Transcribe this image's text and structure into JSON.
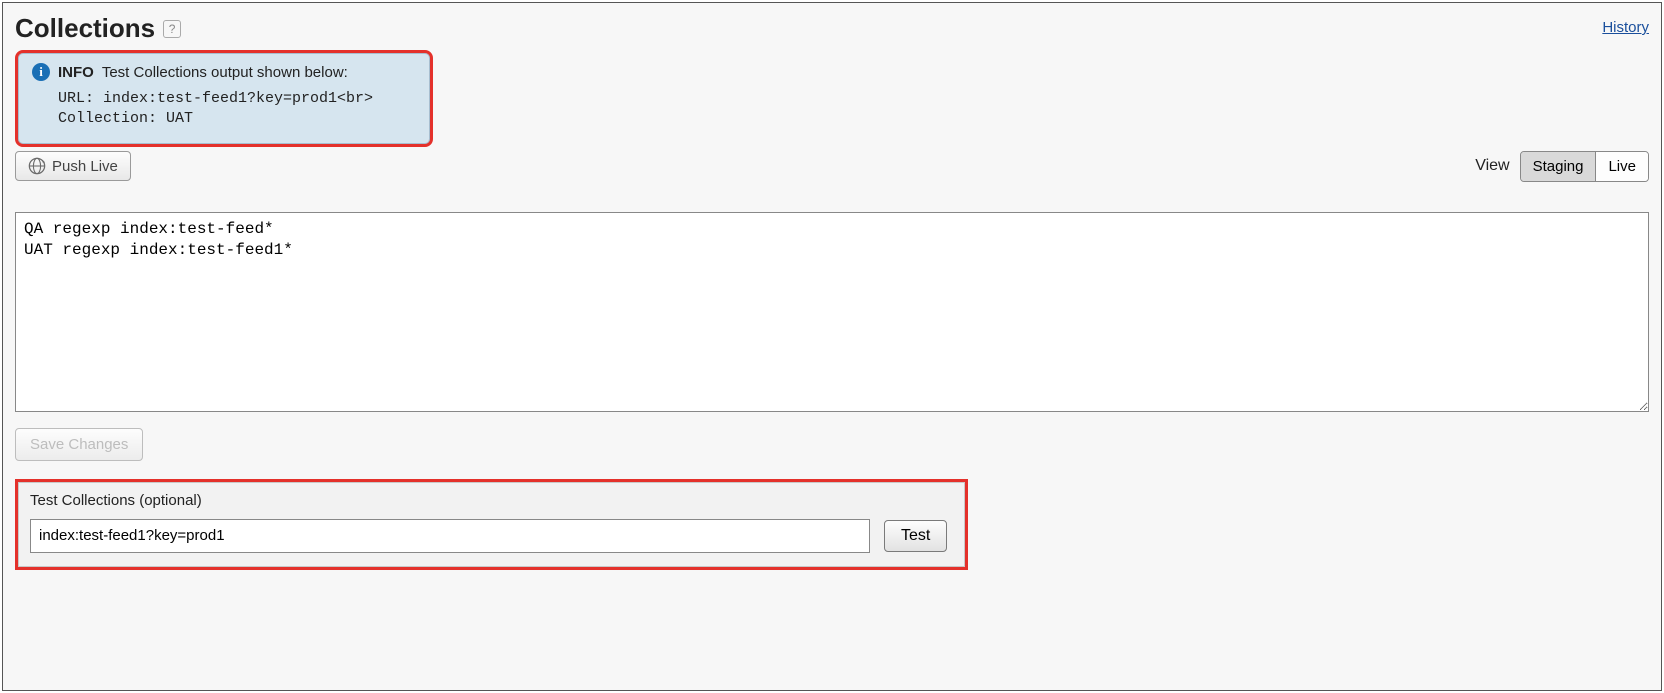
{
  "header": {
    "title": "Collections",
    "history_link": "History"
  },
  "info": {
    "label": "INFO",
    "message": "Test Collections output shown below:",
    "detail": "URL: index:test-feed1?key=prod1<br>\nCollection: UAT"
  },
  "toolbar": {
    "push_live_label": "Push Live",
    "view_label": "View",
    "staging_label": "Staging",
    "live_label": "Live"
  },
  "rules": {
    "content": "QA regexp index:test-feed*\nUAT regexp index:test-feed1*"
  },
  "save": {
    "label": "Save Changes"
  },
  "test": {
    "title": "Test Collections (optional)",
    "input_value": "index:test-feed1?key=prod1",
    "button_label": "Test"
  }
}
